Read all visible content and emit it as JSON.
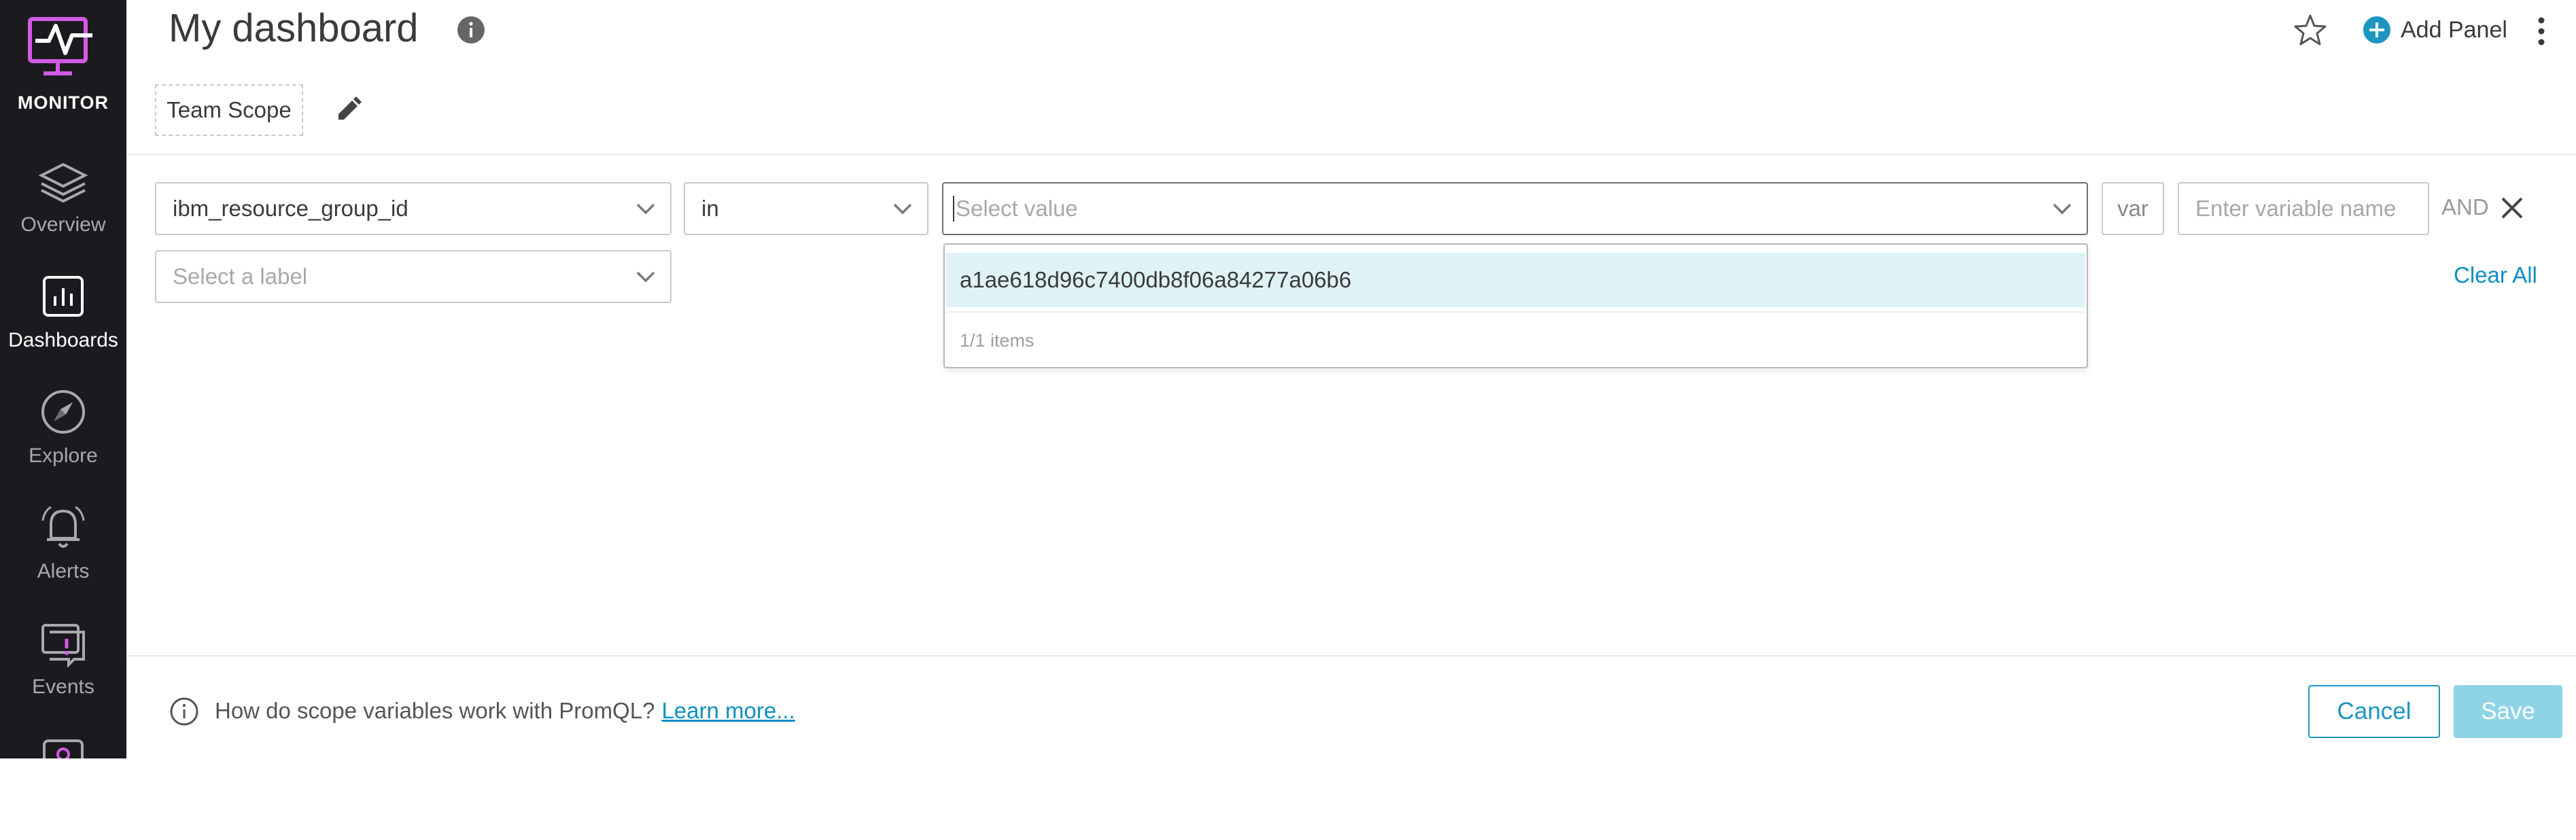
{
  "app": {
    "logo_text": "MONITOR",
    "nav_items": [
      {
        "label": "Overview",
        "icon": "layers-icon"
      },
      {
        "label": "Dashboards",
        "icon": "bar-chart-icon"
      },
      {
        "label": "Explore",
        "icon": "compass-icon"
      },
      {
        "label": "Alerts",
        "icon": "bell-icon"
      },
      {
        "label": "Events",
        "icon": "event-icon"
      }
    ],
    "active_nav": "Dashboards"
  },
  "header": {
    "title": "My dashboard",
    "add_panel_label": "Add Panel"
  },
  "scope": {
    "label": "Team Scope"
  },
  "filter": {
    "label_value": "ibm_resource_group_id",
    "operator_value": "in",
    "value_placeholder": "Select value",
    "var_label": "var",
    "variable_name_placeholder": "Enter variable name",
    "and_label": "AND",
    "second_label_placeholder": "Select a label",
    "clear_all_label": "Clear All"
  },
  "dropdown": {
    "options": [
      "a1ae618d96c7400db8f06a84277a06b6"
    ],
    "count_text": "1/1 items"
  },
  "footer": {
    "help_text": "How do scope variables work with PromQL?",
    "learn_more_label": "Learn more...",
    "cancel_label": "Cancel",
    "save_label": "Save"
  },
  "colors": {
    "accent": "#1c95c2",
    "sidebar_bg": "#1b1b1f",
    "logo_magenta": "#d35ae6",
    "highlight": "#dff3f7",
    "save_disabled": "#8fd3e6"
  }
}
